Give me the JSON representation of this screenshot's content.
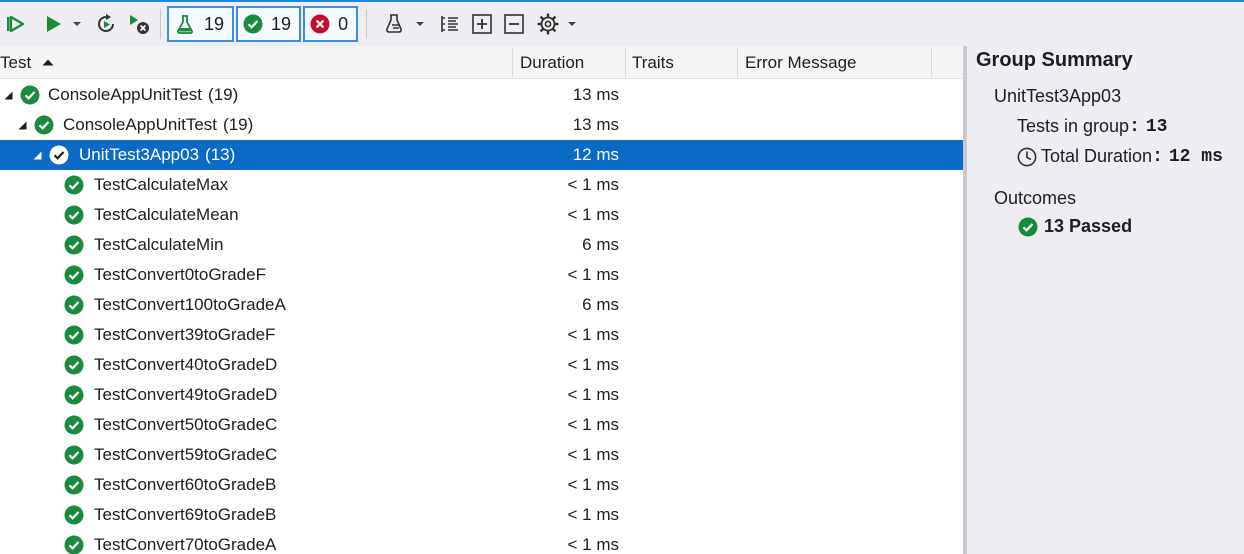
{
  "toolbar": {
    "counters": {
      "total": "19",
      "passed": "19",
      "failed": "0"
    },
    "colors": {
      "accent": "#3c8fe0",
      "pass": "#1a8a3c",
      "fail": "#c8102e",
      "run": "#1a8a3c"
    }
  },
  "columns": {
    "test": "Test",
    "duration": "Duration",
    "traits": "Traits",
    "error": "Error Message"
  },
  "rows": [
    {
      "name": "ConsoleAppUnitTest",
      "count": "(19)",
      "duration": "13 ms",
      "level": 0,
      "expanded": true,
      "selected": false
    },
    {
      "name": "ConsoleAppUnitTest",
      "count": "(19)",
      "duration": "13 ms",
      "level": 1,
      "expanded": true,
      "selected": false
    },
    {
      "name": "UnitTest3App03",
      "count": "(13)",
      "duration": "12 ms",
      "level": 2,
      "expanded": true,
      "selected": true
    },
    {
      "name": "TestCalculateMax",
      "duration": "< 1 ms",
      "level": 3
    },
    {
      "name": "TestCalculateMean",
      "duration": "< 1 ms",
      "level": 3
    },
    {
      "name": "TestCalculateMin",
      "duration": "6 ms",
      "level": 3
    },
    {
      "name": "TestConvert0toGradeF",
      "duration": "< 1 ms",
      "level": 3
    },
    {
      "name": "TestConvert100toGradeA",
      "duration": "6 ms",
      "level": 3
    },
    {
      "name": "TestConvert39toGradeF",
      "duration": "< 1 ms",
      "level": 3
    },
    {
      "name": "TestConvert40toGradeD",
      "duration": "< 1 ms",
      "level": 3
    },
    {
      "name": "TestConvert49toGradeD",
      "duration": "< 1 ms",
      "level": 3
    },
    {
      "name": "TestConvert50toGradeC",
      "duration": "< 1 ms",
      "level": 3
    },
    {
      "name": "TestConvert59toGradeC",
      "duration": "< 1 ms",
      "level": 3
    },
    {
      "name": "TestConvert60toGradeB",
      "duration": "< 1 ms",
      "level": 3
    },
    {
      "name": "TestConvert69toGradeB",
      "duration": "< 1 ms",
      "level": 3
    },
    {
      "name": "TestConvert70toGradeA",
      "duration": "< 1 ms",
      "level": 3
    }
  ],
  "summary": {
    "title": "Group Summary",
    "group_name": "UnitTest3App03",
    "tests_label": "Tests in group",
    "tests_value": "13",
    "duration_label": "Total Duration",
    "duration_value": "12 ms",
    "outcomes_label": "Outcomes",
    "passed_text": "13 Passed"
  }
}
